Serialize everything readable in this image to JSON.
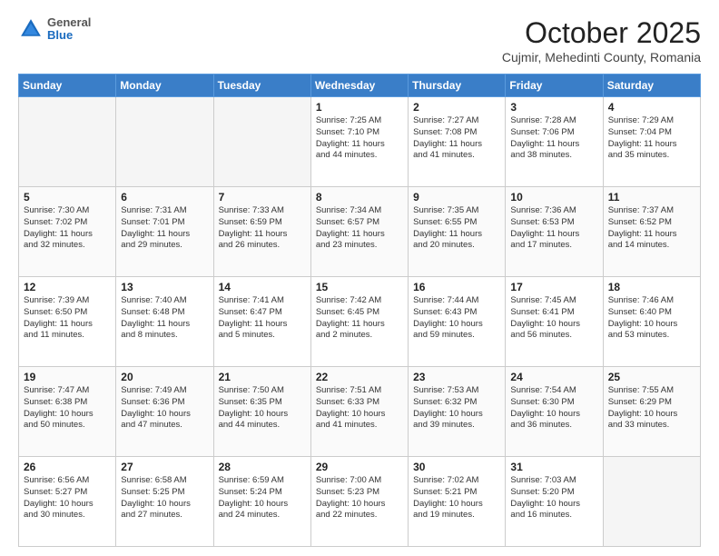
{
  "header": {
    "logo_general": "General",
    "logo_blue": "Blue",
    "month_title": "October 2025",
    "location": "Cujmir, Mehedinti County, Romania"
  },
  "weekdays": [
    "Sunday",
    "Monday",
    "Tuesday",
    "Wednesday",
    "Thursday",
    "Friday",
    "Saturday"
  ],
  "weeks": [
    [
      {
        "day": "",
        "info": ""
      },
      {
        "day": "",
        "info": ""
      },
      {
        "day": "",
        "info": ""
      },
      {
        "day": "1",
        "info": "Sunrise: 7:25 AM\nSunset: 7:10 PM\nDaylight: 11 hours\nand 44 minutes."
      },
      {
        "day": "2",
        "info": "Sunrise: 7:27 AM\nSunset: 7:08 PM\nDaylight: 11 hours\nand 41 minutes."
      },
      {
        "day": "3",
        "info": "Sunrise: 7:28 AM\nSunset: 7:06 PM\nDaylight: 11 hours\nand 38 minutes."
      },
      {
        "day": "4",
        "info": "Sunrise: 7:29 AM\nSunset: 7:04 PM\nDaylight: 11 hours\nand 35 minutes."
      }
    ],
    [
      {
        "day": "5",
        "info": "Sunrise: 7:30 AM\nSunset: 7:02 PM\nDaylight: 11 hours\nand 32 minutes."
      },
      {
        "day": "6",
        "info": "Sunrise: 7:31 AM\nSunset: 7:01 PM\nDaylight: 11 hours\nand 29 minutes."
      },
      {
        "day": "7",
        "info": "Sunrise: 7:33 AM\nSunset: 6:59 PM\nDaylight: 11 hours\nand 26 minutes."
      },
      {
        "day": "8",
        "info": "Sunrise: 7:34 AM\nSunset: 6:57 PM\nDaylight: 11 hours\nand 23 minutes."
      },
      {
        "day": "9",
        "info": "Sunrise: 7:35 AM\nSunset: 6:55 PM\nDaylight: 11 hours\nand 20 minutes."
      },
      {
        "day": "10",
        "info": "Sunrise: 7:36 AM\nSunset: 6:53 PM\nDaylight: 11 hours\nand 17 minutes."
      },
      {
        "day": "11",
        "info": "Sunrise: 7:37 AM\nSunset: 6:52 PM\nDaylight: 11 hours\nand 14 minutes."
      }
    ],
    [
      {
        "day": "12",
        "info": "Sunrise: 7:39 AM\nSunset: 6:50 PM\nDaylight: 11 hours\nand 11 minutes."
      },
      {
        "day": "13",
        "info": "Sunrise: 7:40 AM\nSunset: 6:48 PM\nDaylight: 11 hours\nand 8 minutes."
      },
      {
        "day": "14",
        "info": "Sunrise: 7:41 AM\nSunset: 6:47 PM\nDaylight: 11 hours\nand 5 minutes."
      },
      {
        "day": "15",
        "info": "Sunrise: 7:42 AM\nSunset: 6:45 PM\nDaylight: 11 hours\nand 2 minutes."
      },
      {
        "day": "16",
        "info": "Sunrise: 7:44 AM\nSunset: 6:43 PM\nDaylight: 10 hours\nand 59 minutes."
      },
      {
        "day": "17",
        "info": "Sunrise: 7:45 AM\nSunset: 6:41 PM\nDaylight: 10 hours\nand 56 minutes."
      },
      {
        "day": "18",
        "info": "Sunrise: 7:46 AM\nSunset: 6:40 PM\nDaylight: 10 hours\nand 53 minutes."
      }
    ],
    [
      {
        "day": "19",
        "info": "Sunrise: 7:47 AM\nSunset: 6:38 PM\nDaylight: 10 hours\nand 50 minutes."
      },
      {
        "day": "20",
        "info": "Sunrise: 7:49 AM\nSunset: 6:36 PM\nDaylight: 10 hours\nand 47 minutes."
      },
      {
        "day": "21",
        "info": "Sunrise: 7:50 AM\nSunset: 6:35 PM\nDaylight: 10 hours\nand 44 minutes."
      },
      {
        "day": "22",
        "info": "Sunrise: 7:51 AM\nSunset: 6:33 PM\nDaylight: 10 hours\nand 41 minutes."
      },
      {
        "day": "23",
        "info": "Sunrise: 7:53 AM\nSunset: 6:32 PM\nDaylight: 10 hours\nand 39 minutes."
      },
      {
        "day": "24",
        "info": "Sunrise: 7:54 AM\nSunset: 6:30 PM\nDaylight: 10 hours\nand 36 minutes."
      },
      {
        "day": "25",
        "info": "Sunrise: 7:55 AM\nSunset: 6:29 PM\nDaylight: 10 hours\nand 33 minutes."
      }
    ],
    [
      {
        "day": "26",
        "info": "Sunrise: 6:56 AM\nSunset: 5:27 PM\nDaylight: 10 hours\nand 30 minutes."
      },
      {
        "day": "27",
        "info": "Sunrise: 6:58 AM\nSunset: 5:25 PM\nDaylight: 10 hours\nand 27 minutes."
      },
      {
        "day": "28",
        "info": "Sunrise: 6:59 AM\nSunset: 5:24 PM\nDaylight: 10 hours\nand 24 minutes."
      },
      {
        "day": "29",
        "info": "Sunrise: 7:00 AM\nSunset: 5:23 PM\nDaylight: 10 hours\nand 22 minutes."
      },
      {
        "day": "30",
        "info": "Sunrise: 7:02 AM\nSunset: 5:21 PM\nDaylight: 10 hours\nand 19 minutes."
      },
      {
        "day": "31",
        "info": "Sunrise: 7:03 AM\nSunset: 5:20 PM\nDaylight: 10 hours\nand 16 minutes."
      },
      {
        "day": "",
        "info": ""
      }
    ]
  ]
}
